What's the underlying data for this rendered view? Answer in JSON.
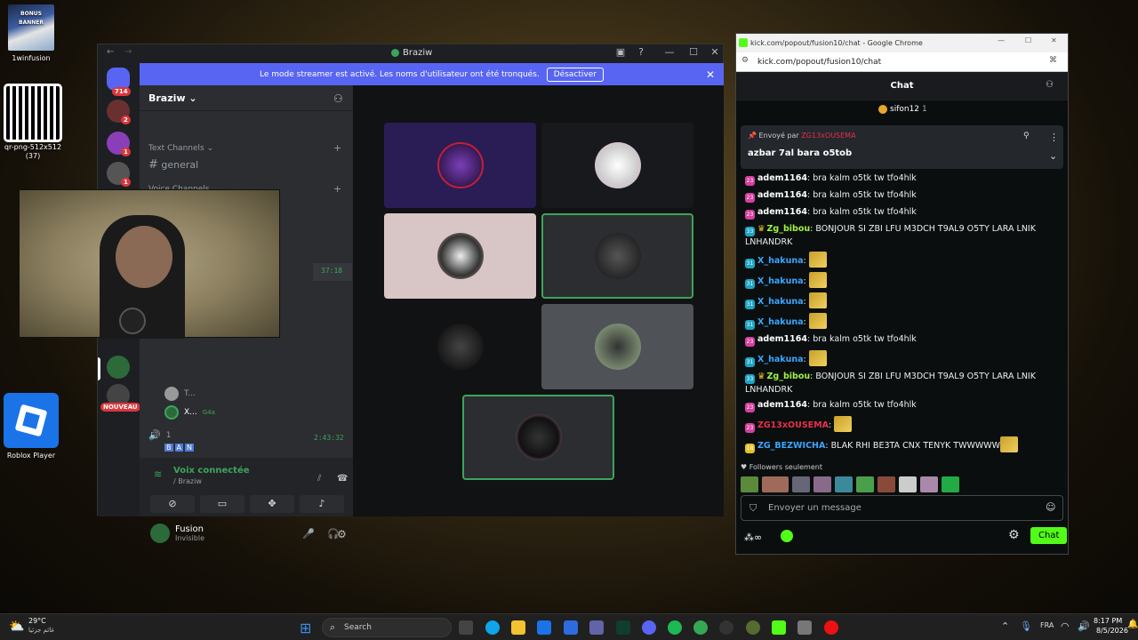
{
  "desktop": {
    "icons": [
      {
        "label": "1winfusion",
        "thumb_text": "BONUS BANNER"
      },
      {
        "label": "qr-png-512x512 (37)"
      },
      {
        "label": "Roblox Player"
      }
    ]
  },
  "webcam": {},
  "discord": {
    "window_title": "Braziw",
    "guild_badges": [
      "714",
      "2",
      "1",
      "1"
    ],
    "new_badge": "NOUVEAU",
    "banner": {
      "text": "Le mode streamer est activé. Les noms d'utilisateur ont été tronqués.",
      "button": "Désactiver"
    },
    "server_name": "Braziw",
    "categories": {
      "text": "Text Channels",
      "voice": "Voice Channels"
    },
    "channel_general": "general",
    "voice_timer_1": "37:18",
    "voice_timer_2": "2:43:32",
    "voice_channel_2": "1",
    "voice_users": [
      {
        "name": "T..."
      },
      {
        "name": "X...",
        "tag": "G4a"
      }
    ],
    "ban_tags": [
      "B",
      "A",
      "N"
    ],
    "voice_status": {
      "label": "Voix connectée",
      "channel": "/ Braziw"
    },
    "user": {
      "name": "Fusion",
      "status": "Invisible"
    }
  },
  "chrome": {
    "tab_title": "kick.com/popout/fusion10/chat - Google Chrome",
    "url": "kick.com/popout/fusion10/chat",
    "chat_title": "Chat",
    "top_gifter": {
      "name": "sifon12",
      "count": "1"
    },
    "pinned": {
      "sent_by_label": "Envoyé par",
      "sent_by_user": "ZG13xOUSEMA",
      "text": "azbar 7al bara o5tob"
    },
    "messages": [
      {
        "badge": "23",
        "badge_color": "#d6409f",
        "user": "adem1164",
        "user_color": "#ffffff",
        "text": "bra kalm o5tk tw tfo4hlk"
      },
      {
        "badge": "23",
        "badge_color": "#d6409f",
        "user": "adem1164",
        "user_color": "#ffffff",
        "text": "bra kalm o5tk tw tfo4hlk"
      },
      {
        "badge": "23",
        "badge_color": "#d6409f",
        "user": "adem1164",
        "user_color": "#ffffff",
        "text": "bra kalm o5tk tw tfo4hlk"
      },
      {
        "badge": "33",
        "badge_color": "#1ba6c4",
        "user": "Zg_bibou",
        "user_color": "#9ef542",
        "text": "BONJOUR SI ZBI LFU M3DCH T9AL9 O5TY LARA LNIK LNHANDRK",
        "crown": true
      },
      {
        "badge": "31",
        "badge_color": "#1ba6c4",
        "user": "X_hakuna",
        "user_color": "#3aa6ff",
        "text": "",
        "emote": true
      },
      {
        "badge": "31",
        "badge_color": "#1ba6c4",
        "user": "X_hakuna",
        "user_color": "#3aa6ff",
        "text": "",
        "emote": true
      },
      {
        "badge": "31",
        "badge_color": "#1ba6c4",
        "user": "X_hakuna",
        "user_color": "#3aa6ff",
        "text": "",
        "emote": true
      },
      {
        "badge": "31",
        "badge_color": "#1ba6c4",
        "user": "X_hakuna",
        "user_color": "#3aa6ff",
        "text": "",
        "emote": true
      },
      {
        "badge": "23",
        "badge_color": "#d6409f",
        "user": "adem1164",
        "user_color": "#ffffff",
        "text": "bra kalm o5tk tw tfo4hlk"
      },
      {
        "badge": "31",
        "badge_color": "#1ba6c4",
        "user": "X_hakuna",
        "user_color": "#3aa6ff",
        "text": "",
        "emote": true
      },
      {
        "badge": "33",
        "badge_color": "#1ba6c4",
        "user": "Zg_bibou",
        "user_color": "#9ef542",
        "text": "BONJOUR SI ZBI LFU M3DCH T9AL9 O5TY LARA LNIK LNHANDRK",
        "crown": true
      },
      {
        "badge": "23",
        "badge_color": "#d6409f",
        "user": "adem1164",
        "user_color": "#ffffff",
        "text": "bra kalm o5tk tw tfo4hlk"
      },
      {
        "badge": "23",
        "badge_color": "#d6409f",
        "user": "ZG13xOUSEMA",
        "user_color": "#e8304a",
        "text": "",
        "emote": true
      },
      {
        "badge": "18",
        "badge_color": "#e6c229",
        "user": "ZG_BEZWICHA",
        "user_color": "#3aa6ff",
        "text": "BLAK RHI BE3TA CNX TENYK TWWWWW",
        "emote": true
      }
    ],
    "followers_only": "Followers seulement",
    "input_placeholder": "Envoyer un message",
    "send_button": "Chat"
  },
  "taskbar": {
    "weather_temp": "29°C",
    "weather_desc": "غائم جزئيا",
    "search_placeholder": "Search",
    "language": "FRA",
    "time": "8:17 PM",
    "date": "8/5/2026"
  }
}
